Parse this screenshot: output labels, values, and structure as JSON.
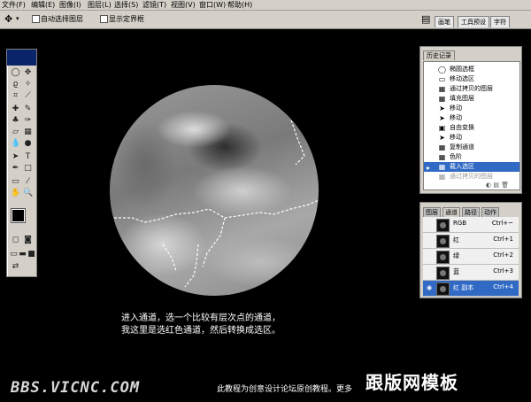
{
  "menu": [
    "文件(F)",
    "编辑(E)",
    "图像(I)",
    "图层(L)",
    "选择(S)",
    "滤镜(T)",
    "视图(V)",
    "窗口(W)",
    "帮助(H)"
  ],
  "options": {
    "auto_select": "自动选择图层",
    "show_bounds": "显示定界框",
    "tabs": [
      "画笔",
      "工具预设",
      "字符"
    ]
  },
  "history": {
    "tab": "历史记录",
    "items": [
      {
        "label": "椭圆选框",
        "icon": "ellipse-marquee-icon"
      },
      {
        "label": "移动选区",
        "icon": "move-icon"
      },
      {
        "label": "通过拷贝的图层",
        "icon": "layer-icon"
      },
      {
        "label": "填充图层",
        "icon": "fill-icon"
      },
      {
        "label": "移动",
        "icon": "move-icon"
      },
      {
        "label": "移动",
        "icon": "move-icon"
      },
      {
        "label": "自由变换",
        "icon": "transform-icon"
      },
      {
        "label": "移动",
        "icon": "move-icon"
      },
      {
        "label": "复制通道",
        "icon": "channel-icon"
      },
      {
        "label": "色阶",
        "icon": "levels-icon"
      },
      {
        "label": "载入选区",
        "icon": "selection-icon"
      },
      {
        "label": "通过拷贝的图层",
        "icon": "layer-icon"
      }
    ]
  },
  "channels": {
    "tabs": [
      "图层",
      "通道",
      "路径",
      "动作"
    ],
    "rows": [
      {
        "name": "RGB",
        "shortcut": "Ctrl+~"
      },
      {
        "name": "红",
        "shortcut": "Ctrl+1"
      },
      {
        "name": "绿",
        "shortcut": "Ctrl+2"
      },
      {
        "name": "蓝",
        "shortcut": "Ctrl+3"
      },
      {
        "name": "红 副本",
        "shortcut": "Ctrl+4"
      }
    ]
  },
  "caption": {
    "line1": "进入通道，选一个比较有层次点的通道，",
    "line2": "我这里是选红色通道，然后转换成选区。"
  },
  "footer": {
    "site": "BBS.VICNC.COM",
    "note": "此教程为创意设计论坛原创教程。更多",
    "brand": "跟版网模板"
  }
}
